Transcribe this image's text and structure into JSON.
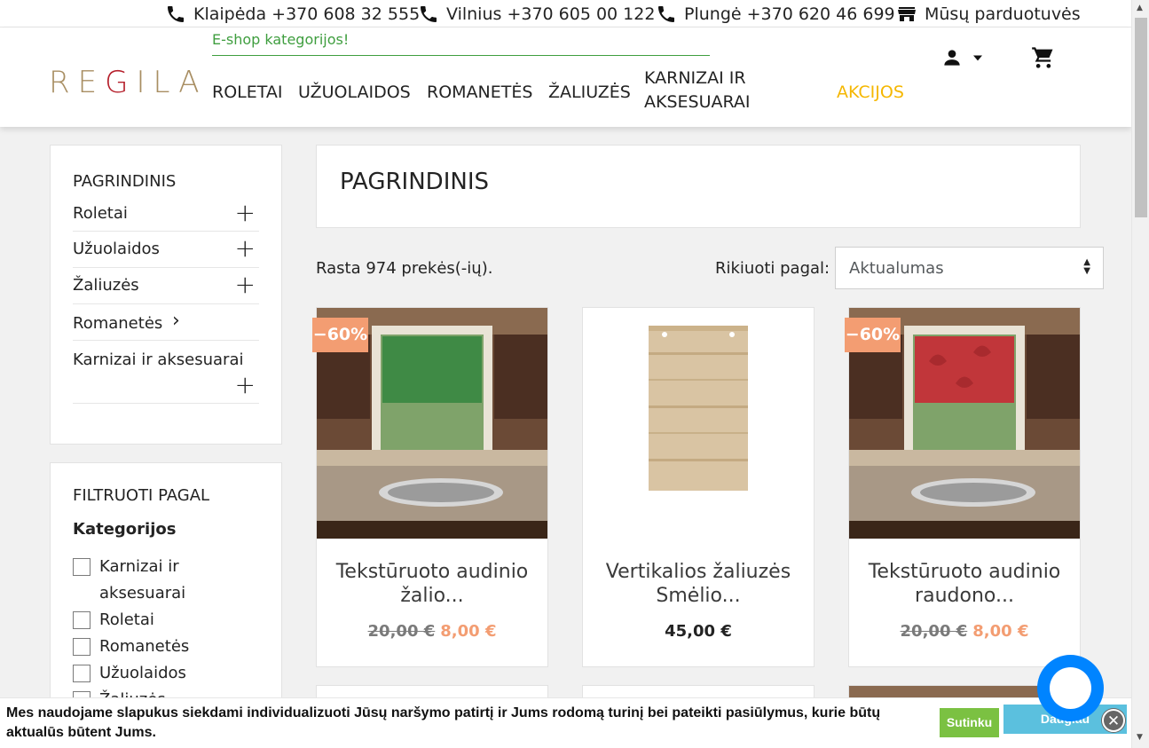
{
  "topbar": {
    "contacts": [
      {
        "label": "Klaipėda +370 608 32 555",
        "icon": "phone-icon"
      },
      {
        "label": "Vilnius +370 605 00 122",
        "icon": "phone-icon"
      },
      {
        "label": "Plungė +370 620 46 699",
        "icon": "phone-icon"
      },
      {
        "label": "Mūsų parduotuvės",
        "icon": "store-icon"
      }
    ]
  },
  "header": {
    "logo": "REGILA",
    "eshop_label": "E-shop kategorijos!",
    "nav": [
      "ROLETAI",
      "UŽUOLAIDOS",
      "ROMANETĖS",
      "ŽALIUZĖS",
      "KARNIZAI IR AKSESUARAI",
      "AKCIJOS"
    ],
    "accent_color": "#f5b700"
  },
  "sidebar": {
    "categories_title": "PAGRINDINIS",
    "categories": [
      {
        "label": "Roletai",
        "control": "plus"
      },
      {
        "label": "Užuolaidos",
        "control": "plus"
      },
      {
        "label": "Žaliuzės",
        "control": "plus"
      },
      {
        "label": "Romanetės",
        "control": "chevron"
      },
      {
        "label": "Karnizai ir aksesuarai",
        "control": "plus"
      }
    ],
    "filter_title": "FILTRUOTI PAGAL",
    "filter_subtitle": "Kategorijos",
    "filters": [
      "Karnizai ir aksesuarai",
      "Roletai",
      "Romanetės",
      "Užuolaidos",
      "Žaliuzės"
    ]
  },
  "main": {
    "title": "PAGRINDINIS",
    "result_count": "Rasta 974 prekės(-ių).",
    "sort_label": "Rikiuoti pagal:",
    "sort_value": "Aktualumas",
    "products": [
      {
        "name": "Tekstūruoto audinio žalio...",
        "old_price": "20,00 €",
        "price": "8,00 €",
        "badge": "−60%",
        "blind_color": "#3f8a45"
      },
      {
        "name": "Vertikalios žaliuzės Smėlio...",
        "old_price": "",
        "price": "45,00 €",
        "badge": "",
        "blind_color": "#d9c4a3"
      },
      {
        "name": "Tekstūruoto audinio raudono...",
        "old_price": "20,00 €",
        "price": "8,00 €",
        "badge": "−60%",
        "blind_color": "#c1363a"
      }
    ]
  },
  "cookie": {
    "message": "Mes naudojame slapukus siekdami individualizuoti Jūsų naršymo patirtį ir Jums rodomą turinį bei pateikti pasiūlymus, kurie būtų aktualūs būtent Jums.",
    "agree_label": "Sutinku",
    "more_label": "Daugiau"
  }
}
